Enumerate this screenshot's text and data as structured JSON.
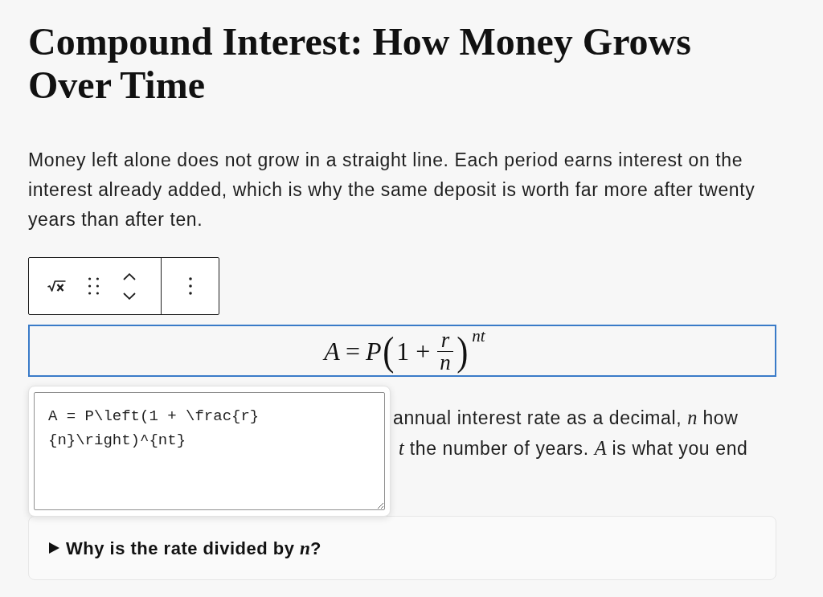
{
  "title": "Compound Interest: How Money Grows Over Time",
  "intro": "Money left alone does not grow in a straight line. Each period earns interest on the interest already added, which is why the same deposit is worth far more after twenty years than after ten.",
  "formula_block": {
    "selected": true,
    "formula": [
      {
        "kind": "var",
        "text": "A"
      },
      {
        "kind": "op",
        "text": "="
      },
      {
        "kind": "var",
        "text": "P"
      },
      {
        "kind": "paren",
        "text": "("
      },
      {
        "kind": "num",
        "text": "1"
      },
      {
        "kind": "op",
        "text": "+"
      },
      {
        "kind": "frac",
        "numerator": "r",
        "denominator": "n"
      },
      {
        "kind": "paren",
        "text": ")"
      },
      {
        "kind": "sup",
        "text": "nt"
      }
    ]
  },
  "latex_popover": {
    "value": "A = P\\left(1 + \\frac{r}{n}\\right)^{nt}"
  },
  "explanation_lines": [
    "annual interest rate as a decimal, *n* how",
    "*t* the number of years. *A* is what you end"
  ],
  "details": {
    "summary": "Why is the rate divided by *n*?",
    "expanded": false
  }
}
